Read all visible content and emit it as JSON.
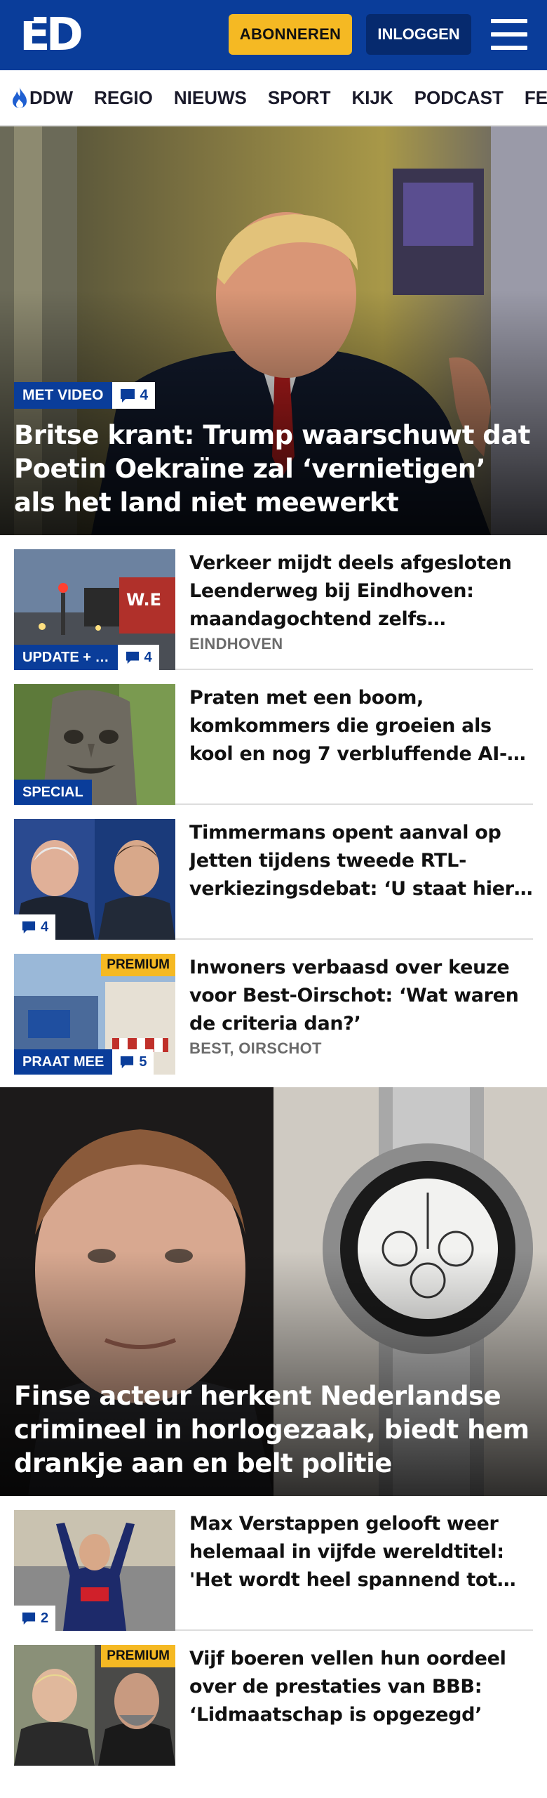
{
  "header": {
    "logo": "ED",
    "subscribe_label": "ABONNEREN",
    "login_label": "INLOGGEN",
    "colors": {
      "brand_blue": "#0a3d9a",
      "accent_yellow": "#f5b923"
    }
  },
  "nav": {
    "items": [
      {
        "label": "DDW",
        "icon": "flame-icon"
      },
      {
        "label": "REGIO"
      },
      {
        "label": "NIEUWS"
      },
      {
        "label": "SPORT"
      },
      {
        "label": "KIJK"
      },
      {
        "label": "PODCAST"
      },
      {
        "label": "FEE"
      }
    ]
  },
  "hero1": {
    "tag": "MET VIDEO",
    "comments": "4",
    "title": "Britse krant: Trump waarschuwt dat Poetin Oekraïne zal ‘vernietigen’ als het land niet meewerkt"
  },
  "articles1": [
    {
      "title": "Verkeer mijdt deels afgesloten Leenderweg bij Eindhoven: maandagochtend zelfs rustiger…",
      "location": "EINDHOVEN",
      "tag": "UPDATE + …",
      "comments": "4"
    },
    {
      "title": "Praten met een boom, komkommers die groeien als kool en nog 7 verbluffende AI-…",
      "tag": "SPECIAL"
    },
    {
      "title": "Timmermans opent aanval op Jetten tijdens tweede RTL-verkiezingsdebat: ‘U staat hier…",
      "comments": "4"
    },
    {
      "title": "Inwoners verbaasd over keuze voor Best-Oirschot: ‘Wat waren de criteria dan?’",
      "location": "BEST, OIRSCHOT",
      "tag": "PRAAT MEE",
      "comments": "5",
      "premium": "PREMIUM"
    }
  ],
  "hero2": {
    "title": "Finse acteur herkent Nederlandse crimineel in horlogezaak, biedt hem drankje aan en belt politie"
  },
  "articles2": [
    {
      "title": "Max Verstappen gelooft weer helemaal in vijfde wereldtitel: 'Het wordt heel spannend tot de…",
      "comments": "2"
    },
    {
      "title": "Vijf boeren vellen hun oordeel over de prestaties van BBB: ‘Lidmaatschap is opgezegd’",
      "premium": "PREMIUM"
    }
  ]
}
